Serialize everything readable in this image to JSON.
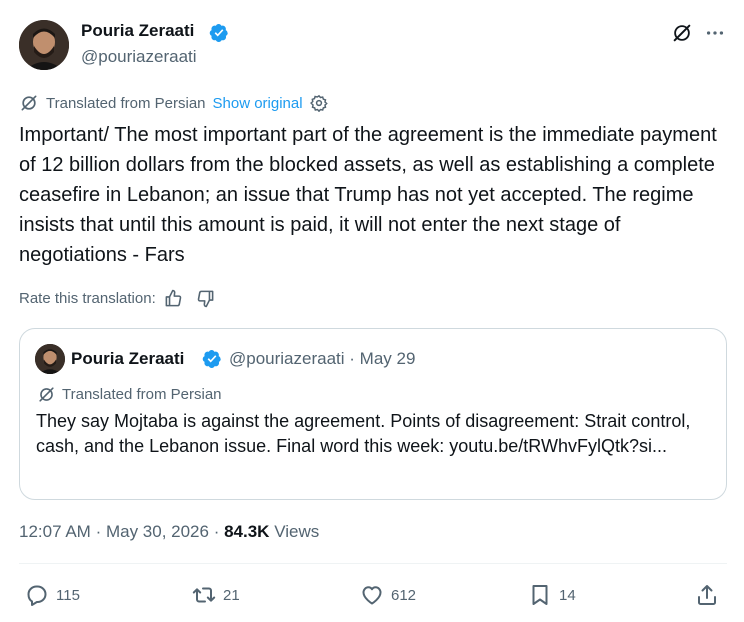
{
  "author": {
    "name": "Pouria Zeraati",
    "handle": "@pouriazeraati"
  },
  "header_icons": [
    "grok-icon",
    "more-icon"
  ],
  "translation": {
    "label": "Translated from Persian",
    "show_original": "Show original",
    "rate_label": "Rate this translation:"
  },
  "tweet": {
    "text": "Important/ The most important part of the agreement is the immediate payment of 12 billion dollars from the blocked assets, as well as establishing a complete ceasefire in Lebanon; an issue that Trump has not yet accepted. The regime insists that until this amount is paid, it will not enter the next stage of negotiations - Fars",
    "time": "12:07 AM",
    "date": "May 30, 2026",
    "views": "84.3K",
    "views_label": "Views"
  },
  "quote": {
    "name": "Pouria Zeraati",
    "handle": "@pouriazeraati",
    "date": "May 29",
    "translation_label": "Translated from Persian",
    "text": "They say Mojtaba is against the agreement. Points of disagreement: Strait control, cash, and the Lebanon issue. Final word this week: youtu.be/tRWhvFylQtk?si..."
  },
  "actions": {
    "replies": "115",
    "reposts": "21",
    "likes": "612",
    "bookmarks": "14"
  },
  "colors": {
    "link": "#1d9bf0",
    "secondary_text": "#536471",
    "primary_text": "#0f1419",
    "border": "#cfd9de"
  }
}
